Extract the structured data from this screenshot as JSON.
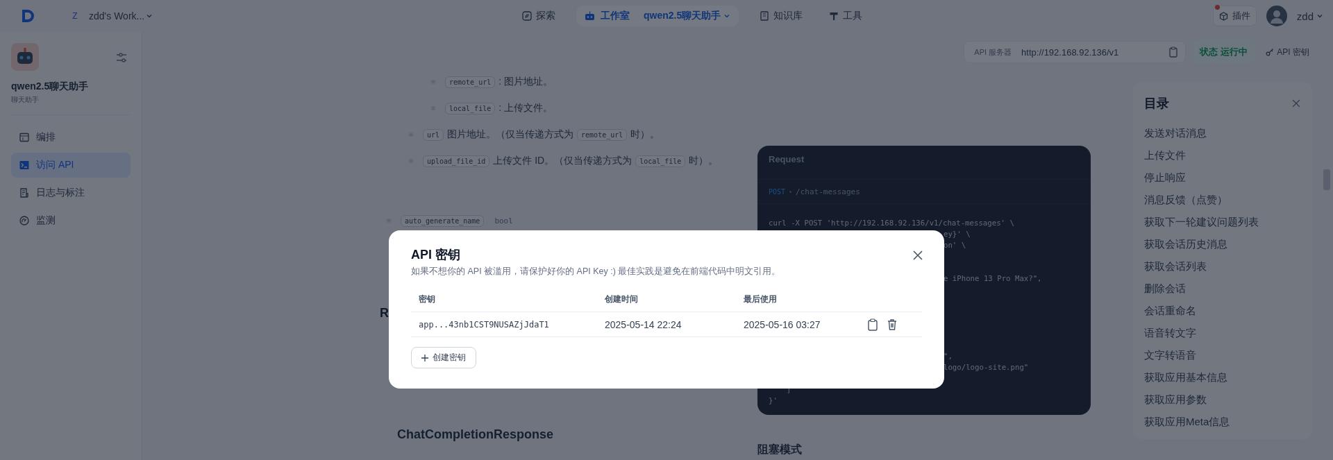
{
  "top_bar": {
    "workspace": {
      "initial": "Z",
      "name": "zdd's Work..."
    },
    "nav": [
      {
        "label": "探索",
        "selected": false,
        "kind": "compass"
      },
      {
        "label": "工作室",
        "selected": true,
        "kind": "robot",
        "app": "qwen2.5聊天助手"
      },
      {
        "label": "知识库",
        "selected": false,
        "kind": "book"
      },
      {
        "label": "工具",
        "selected": false,
        "kind": "hammer"
      }
    ],
    "plugins": {
      "label": "插件",
      "notification": true
    },
    "user": {
      "name": "zdd"
    }
  },
  "sidebar": {
    "app": {
      "name": "qwen2.5聊天助手",
      "type": "聊天助手"
    },
    "items": [
      {
        "label": "编排",
        "selected": false,
        "kind": "layout"
      },
      {
        "label": "访问 API",
        "selected": true,
        "kind": "terminal"
      },
      {
        "label": "日志与标注",
        "selected": false,
        "kind": "log"
      },
      {
        "label": "监测",
        "selected": false,
        "kind": "gauge"
      }
    ]
  },
  "api_bar": {
    "server_label": "API 服务器",
    "server_url": "http://192.168.92.136/v1",
    "status_label": "状态",
    "status": "运行中",
    "keys_button": "API 密钥"
  },
  "doc": {
    "list": [
      {
        "children": [
          {
            "children": [
              {
                "parts": [
                  {
                    "kind": "code",
                    "text": "remote_url"
                  },
                  {
                    "kind": "text",
                    "text": ": 图片地址。"
                  }
                ]
              },
              {
                "parts": [
                  {
                    "kind": "code",
                    "text": "local_file"
                  },
                  {
                    "kind": "text",
                    "text": ": 上传文件。"
                  }
                ]
              }
            ]
          },
          {
            "parts": [
              {
                "kind": "code",
                "text": "url"
              },
              {
                "kind": "text",
                "text": "图片地址。（仅当传递方式为"
              },
              {
                "kind": "code",
                "text": "remote_url"
              },
              {
                "kind": "text",
                "text": "时）。"
              }
            ]
          },
          {
            "parts": [
              {
                "kind": "code",
                "text": "upload_file_id"
              },
              {
                "kind": "text",
                "text": "上传文件 ID。（仅当传递方式为"
              },
              {
                "kind": "code",
                "text": "local_file"
              },
              {
                "kind": "text",
                "text": "时）。"
              }
            ]
          }
        ]
      },
      {
        "parts": [
          {
            "kind": "code",
            "text": "auto_generate_name"
          },
          {
            "kind": "type",
            "text": "bool"
          }
        ]
      }
    ],
    "heading_fragment": "R",
    "section_title": "ChatCompletionResponse"
  },
  "code_panel": {
    "title": "Request",
    "method": "POST",
    "path": "/chat-messages",
    "lines": [
      {
        "kind": "full",
        "text": "curl -X POST 'http://192.168.92.136/v1/chat-messages' \\"
      },
      {
        "kind": "tail",
        "text": "ey}' \\"
      },
      {
        "kind": "tail",
        "text": "on' \\"
      },
      {
        "kind": "blank"
      },
      {
        "kind": "blank"
      },
      {
        "kind": "tail",
        "text": "e iPhone 13 Pro Max?\","
      },
      {
        "kind": "blank"
      },
      {
        "kind": "blank"
      },
      {
        "kind": "blank"
      },
      {
        "kind": "blank"
      },
      {
        "kind": "blank"
      },
      {
        "kind": "blank"
      },
      {
        "kind": "tail",
        "text": "\","
      },
      {
        "kind": "tail",
        "text": "logo/logo-site.png\""
      },
      {
        "kind": "blank"
      },
      {
        "kind": "full",
        "text": "    ]"
      },
      {
        "kind": "full",
        "text": "}'"
      }
    ]
  },
  "blocking_title": "阻塞模式",
  "toc": {
    "title": "目录",
    "items": [
      "发送对话消息",
      "上传文件",
      "停止响应",
      "消息反馈（点赞）",
      "获取下一轮建议问题列表",
      "获取会话历史消息",
      "获取会话列表",
      "删除会话",
      "会话重命名",
      "语音转文字",
      "文字转语音",
      "获取应用基本信息",
      "获取应用参数",
      "获取应用Meta信息"
    ]
  },
  "modal": {
    "title": "API 密钥",
    "description": "如果不想你的 API 被滥用，请保护好你的 API Key :) 最佳实践是避免在前端代码中明文引用。",
    "columns": [
      "密钥",
      "创建时间",
      "最后使用"
    ],
    "rows": [
      {
        "key": "app...43nb1CST9NUSAZjJdaT1",
        "created": "2025-05-14 22:24",
        "last_used": "2025-05-16 03:27"
      }
    ],
    "create_button": "创建密钥"
  }
}
